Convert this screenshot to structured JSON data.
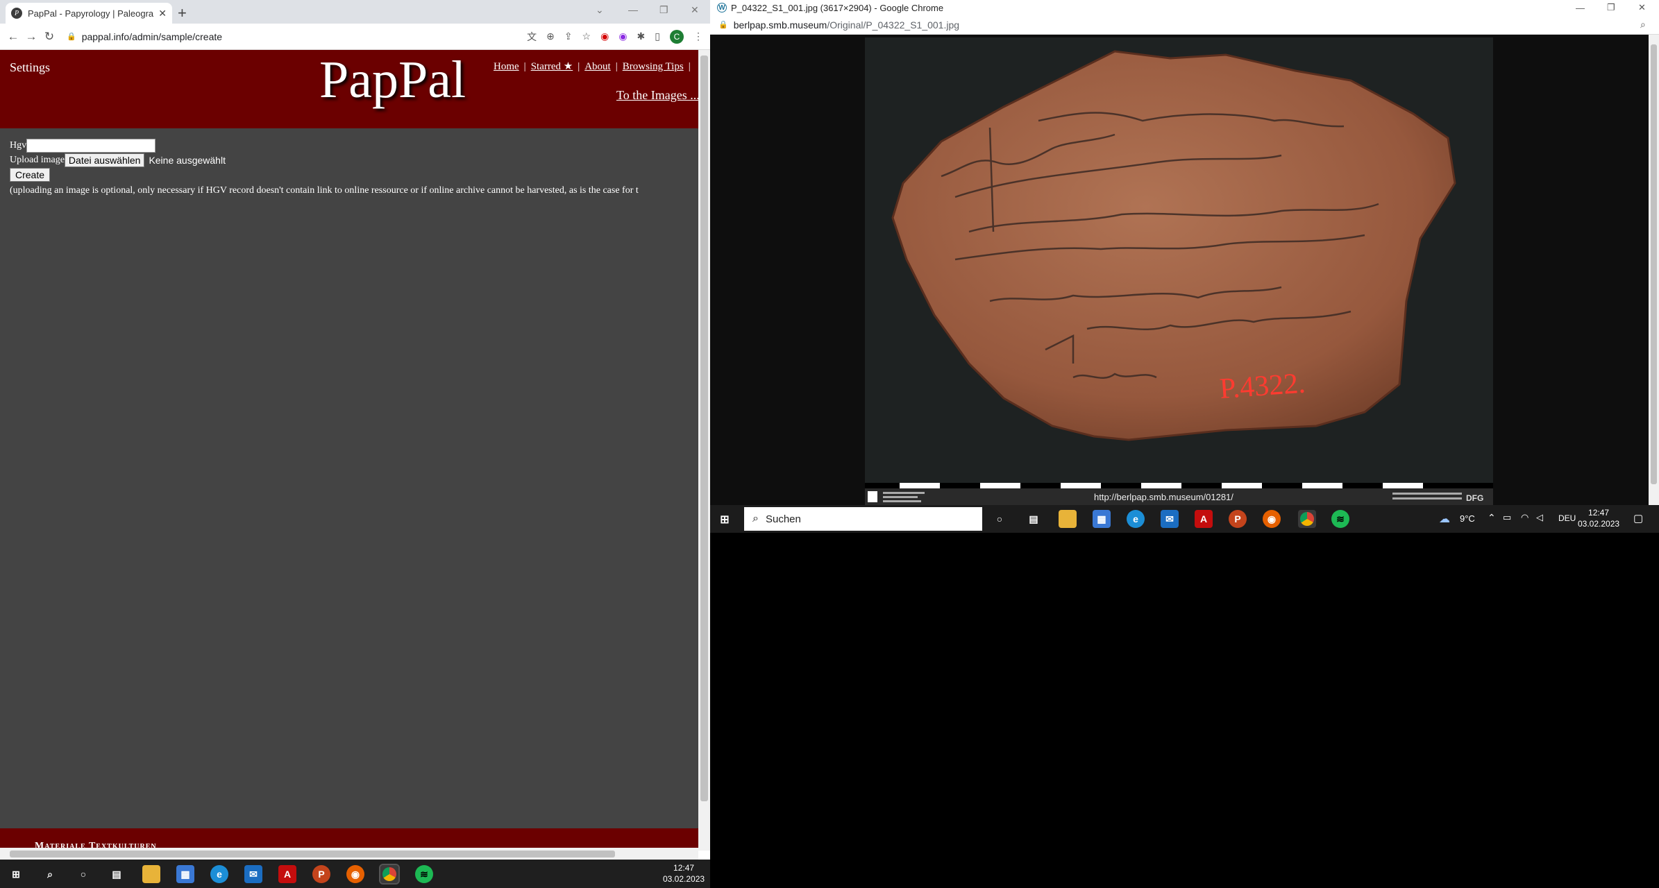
{
  "left_window": {
    "tab_title": "PapPal - Papyrology | Paleograph",
    "url": "pappal.info/admin/sample/create",
    "page": {
      "settings_label": "Settings",
      "logo": "PapPal",
      "nav": [
        "Home",
        "Starred ★",
        "About",
        "Browsing Tips"
      ],
      "to_images": "To the Images ...",
      "hgv_label": "Hgv",
      "upload_label": "Upload image",
      "file_button": "Datei auswählen",
      "no_file": "Keine ausgewählt",
      "create_button": "Create",
      "note": "(uploading an image is optional, only necessary if HGV record doesn't contain link to online ressource or if online archive cannot be harvested, as is the case for t",
      "footer_text": "Materiale Textkulturen"
    },
    "taskbar": {
      "time": "12:47",
      "date": "03.02.2023"
    }
  },
  "right_window": {
    "title": "P_04322_S1_001.jpg (3617×2904) - Google Chrome",
    "url_domain": "berlpap.smb.museum",
    "url_path": "/Original/P_04322_S1_001.jpg",
    "image": {
      "inventory_label": "P.4322.",
      "caption_url": "http://berlpap.smb.museum/01281/"
    },
    "taskbar": {
      "search_placeholder": "Suchen",
      "weather": "9°C",
      "lang": "DEU",
      "time": "12:47",
      "date": "03.02.2023"
    }
  },
  "colors": {
    "header_bg": "#6b0000",
    "page_bg": "#444444",
    "stamp_red": "#ff3b30"
  }
}
